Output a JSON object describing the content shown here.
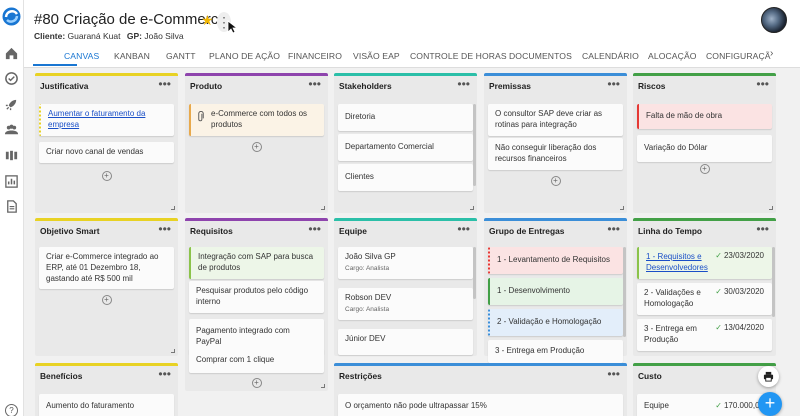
{
  "project": {
    "title": "#80 Criação de e-Commerce",
    "client_label": "Cliente:",
    "client_value": "Guaraná Kuat",
    "gp_label": "GP:",
    "gp_value": "João Silva"
  },
  "tabs": [
    "CANVAS",
    "KANBAN",
    "GANTT",
    "PLANO DE AÇÃO",
    "FINANCEIRO",
    "VISÃO EAP",
    "CONTROLE DE HORAS",
    "DOCUMENTOS",
    "CALENDÁRIO",
    "ALOCAÇÃO",
    "CONFIGURAÇÃ"
  ],
  "active_tab": "CANVAS",
  "colors": {
    "accent": "#1976d2",
    "fab": "#2196f3",
    "yellow": "#e8d224",
    "purple": "#8e44ad",
    "teal": "#2bbfa8",
    "blue": "#3b8ed8",
    "green": "#43a047",
    "red": "#e53935",
    "check": "#43a047"
  },
  "icons": [
    "app-logo-icon",
    "home-icon",
    "check-circle-icon",
    "rocket-icon",
    "people-icon",
    "timeline-icon",
    "chart-icon",
    "document-icon",
    "help-icon",
    "star-icon",
    "more-vert-icon",
    "attachment-icon",
    "print-icon",
    "add-icon",
    "check-icon"
  ],
  "board": {
    "justificativa": {
      "title": "Justificativa",
      "cards": [
        "Aumentar o faturamento da empresa",
        "Criar novo canal de vendas"
      ]
    },
    "produto": {
      "title": "Produto",
      "cards": [
        "e-Commerce com todos os produtos"
      ]
    },
    "stakeholders": {
      "title": "Stakeholders",
      "cards": [
        "Diretoria",
        "Departamento Comercial",
        "Clientes"
      ]
    },
    "premissas": {
      "title": "Premissas",
      "cards": [
        "O consultor SAP deve criar as rotinas para integração",
        "Não conseguir liberação dos recursos financeiros"
      ]
    },
    "riscos": {
      "title": "Riscos",
      "cards": [
        "Falta de mão de obra",
        "Variação do Dólar"
      ]
    },
    "objetivo": {
      "title": "Objetivo Smart",
      "cards": [
        "Criar e-Commerce integrado ao ERP, até 01 Dezembro 18, gastando até R$ 500 mil"
      ]
    },
    "requisitos": {
      "title": "Requisitos",
      "cards": [
        "Integração com SAP para busca de produtos",
        "Pesquisar produtos pelo código interno",
        "Pagamento integrado com PayPal",
        "Comprar com 1 clique"
      ]
    },
    "equipe": {
      "title": "Equipe",
      "cards": [
        {
          "name": "João Silva GP",
          "role": "Cargo: Analista"
        },
        {
          "name": "Robson DEV",
          "role": "Cargo: Analista"
        },
        {
          "name": "Júnior DEV",
          "role": ""
        }
      ]
    },
    "entregas": {
      "title": "Grupo de Entregas",
      "cards": [
        "1 - Levantamento de Requisitos",
        "1 - Desenvolvimento",
        "2 - Validação e Homologação",
        "3 - Entrega em Produção"
      ]
    },
    "linha": {
      "title": "Linha do Tempo",
      "cards": [
        {
          "text": "1 - Requisitos e Desenvolvedores",
          "date": "23/03/2020"
        },
        {
          "text": "2 - Validações e Homologação",
          "date": "30/03/2020"
        },
        {
          "text": "3 - Entrega em Produção",
          "date": "13/04/2020"
        }
      ]
    },
    "beneficios": {
      "title": "Benefícios",
      "cards": [
        "Aumento do faturamento"
      ]
    },
    "restricoes": {
      "title": "Restrições",
      "cards": [
        "O orçamento não pode ultrapassar 15%"
      ]
    },
    "custo": {
      "title": "Custo",
      "cards": [
        {
          "text": "Equipe",
          "value": "170.000,00"
        }
      ]
    }
  },
  "menu_dots": "•••",
  "add_symbol": "+"
}
